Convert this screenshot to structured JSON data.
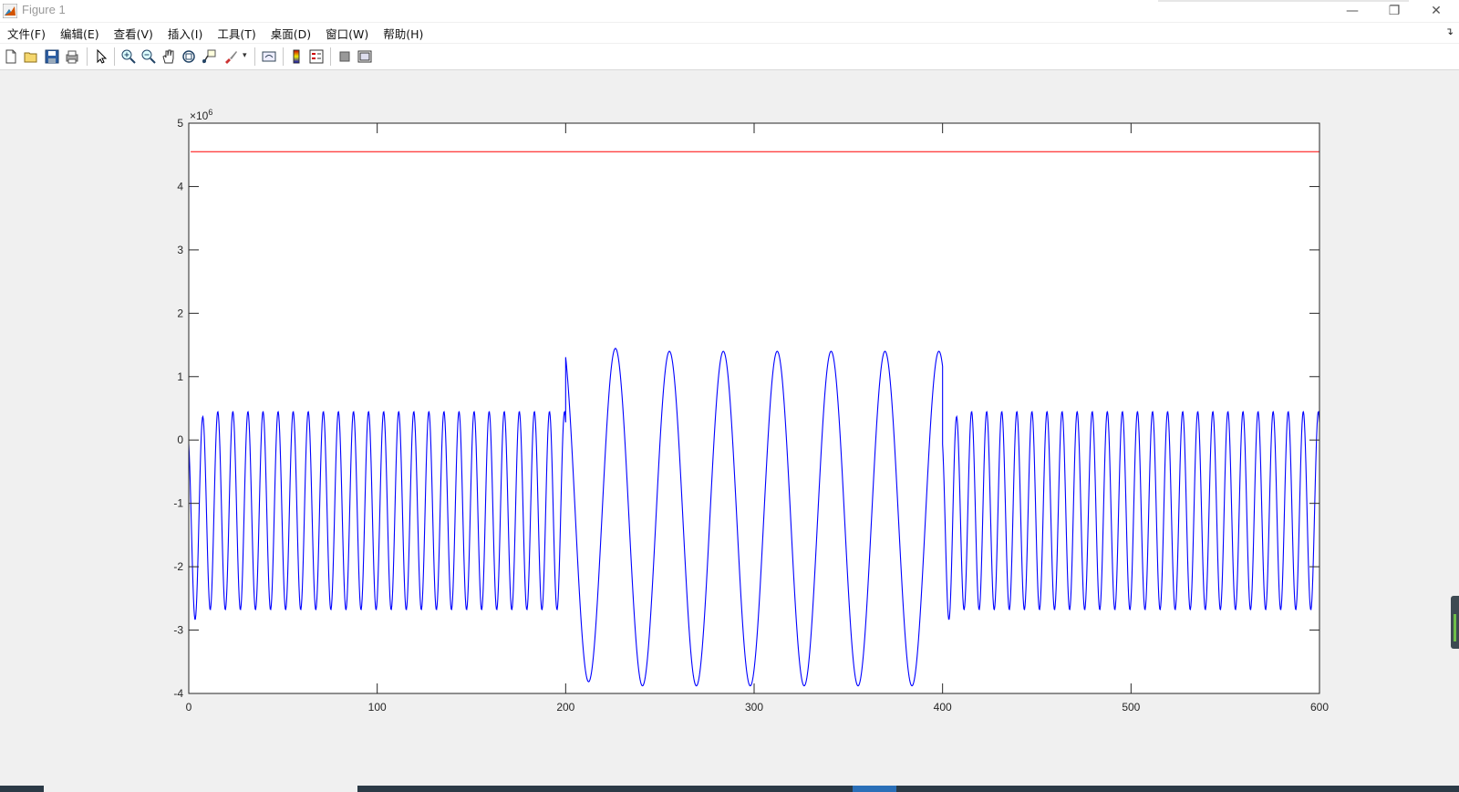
{
  "window": {
    "title": "Figure 1"
  },
  "menu": [
    "文件(F)",
    "编辑(E)",
    "查看(V)",
    "插入(I)",
    "工具(T)",
    "桌面(D)",
    "窗口(W)",
    "帮助(H)"
  ],
  "toolbar": {
    "icons": [
      "new-figure-icon",
      "open-file-icon",
      "save-icon",
      "print-icon",
      "pointer-icon",
      "zoom-in-icon",
      "zoom-out-icon",
      "pan-icon",
      "rotate-3d-icon",
      "data-cursor-icon",
      "brush-icon",
      "link-plot-icon",
      "colorbar-icon",
      "legend-icon",
      "hide-plot-tools-icon",
      "show-plot-tools-icon"
    ]
  },
  "chart_data": {
    "type": "line",
    "title": "",
    "xlabel": "",
    "ylabel": "",
    "xlim": [
      0,
      600
    ],
    "ylim": [
      -4,
      5
    ],
    "y_exponent_label": "×10",
    "y_exponent": "6",
    "xticks": [
      0,
      100,
      200,
      300,
      400,
      500,
      600
    ],
    "yticks": [
      -4,
      -3,
      -2,
      -1,
      0,
      1,
      2,
      3,
      4,
      5
    ],
    "grid": false,
    "series": [
      {
        "color": "#ff0000",
        "x": [
          1,
          600
        ],
        "y": [
          4.55,
          4.55
        ]
      },
      {
        "color": "#0000ff",
        "segments": [
          {
            "x_start": 0,
            "x_end": 200,
            "period": 8,
            "peak": 0.45,
            "trough": -2.68,
            "first_peak": 0.1,
            "first_trough": -2.92
          },
          {
            "x_start": 200,
            "x_end": 400,
            "period": 28.6,
            "peak": 1.4,
            "trough": -3.88,
            "first_peak": 1.6,
            "first_trough": -3.78
          },
          {
            "x_start": 400,
            "x_end": 600,
            "period": 8,
            "peak": 0.45,
            "trough": -2.68,
            "first_peak": 0.1,
            "first_trough": -2.92
          }
        ]
      }
    ]
  },
  "colors": {
    "blue_line": "#0000ff",
    "red_line": "#ff0000",
    "axes": "#262626"
  }
}
